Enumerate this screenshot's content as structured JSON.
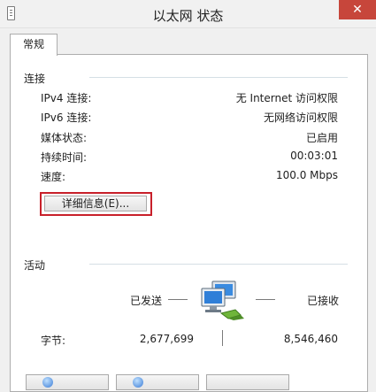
{
  "window": {
    "title": "以太网 状态",
    "close_glyph": "✕",
    "close_color": "#c7463b"
  },
  "tabs": [
    {
      "label": "常规",
      "selected": true
    }
  ],
  "connection": {
    "group_label": "连接",
    "rows": [
      {
        "label": "IPv4 连接:",
        "value": "无 Internet 访问权限"
      },
      {
        "label": "IPv6 连接:",
        "value": "无网络访问权限"
      },
      {
        "label": "媒体状态:",
        "value": "已启用"
      },
      {
        "label": "持续时间:",
        "value": "00:03:01"
      },
      {
        "label": "速度:",
        "value": "100.0 Mbps"
      }
    ],
    "details_button": "详细信息(E)...",
    "highlight_color": "#c8202a"
  },
  "activity": {
    "group_label": "活动",
    "sent_label": "已发送",
    "received_label": "已接收",
    "bytes_label": "字节:",
    "bytes_sent": "2,677,699",
    "bytes_received": "8,546,460",
    "icon": "network-computers-icon"
  },
  "footer": {
    "buttons": [
      {
        "icon": "shield-icon"
      },
      {
        "icon": "shield-icon"
      },
      {
        "icon": "blank"
      }
    ]
  }
}
